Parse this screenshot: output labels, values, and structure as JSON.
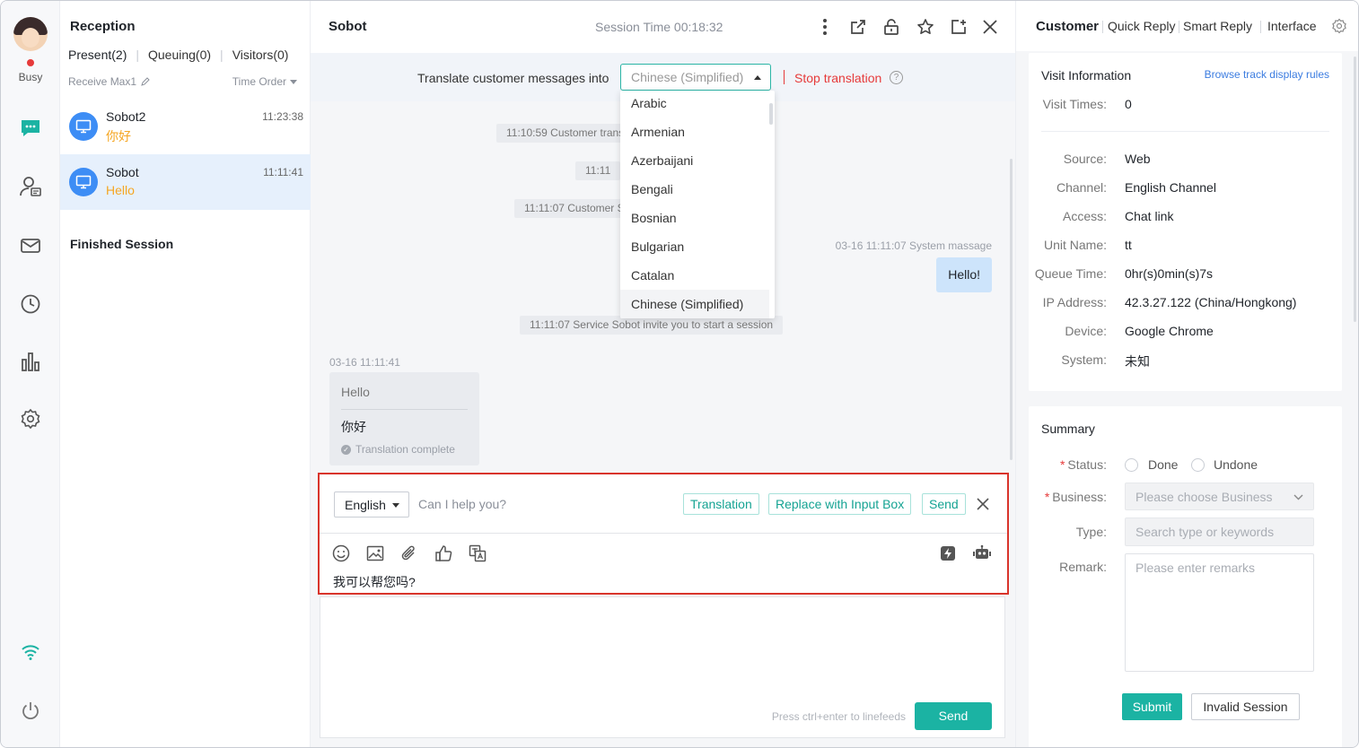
{
  "rail": {
    "status": "Busy",
    "icons": [
      "chat-icon",
      "contacts-icon",
      "mail-icon",
      "history-icon",
      "statistics-icon",
      "settings-icon",
      "wifi-icon",
      "power-icon"
    ]
  },
  "sessions": {
    "title": "Reception",
    "tabs": [
      {
        "label": "Present(2)"
      },
      {
        "label": "Queuing(0)"
      },
      {
        "label": "Visitors(0)"
      }
    ],
    "receive_max": "Receive Max1",
    "time_order": "Time Order",
    "items": [
      {
        "name": "Sobot2",
        "time": "11:23:38",
        "message": "你好"
      },
      {
        "name": "Sobot",
        "time": "11:11:41",
        "message": "Hello"
      }
    ],
    "finished_title": "Finished Session"
  },
  "chat": {
    "name": "Sobot",
    "session_time": "Session Time 00:18:32",
    "translate_label": "Translate customer messages into",
    "target_language": "Chinese (Simplified)",
    "stop_translation": "Stop translation",
    "help_glyph": "?",
    "notes": [
      {
        "text": "11:10:59 Customer transfer to service"
      },
      {
        "text": "11:11:07 Customer Sobot"
      },
      {
        "text": "11:11:07 Service Sobot invite you to start a session"
      }
    ],
    "partial_note": "11:11",
    "outgoing_meta": "03-16 11:11:07   System massage",
    "outgoing_text": "Hello!",
    "incoming_meta": "03-16 11:11:41",
    "incoming_original": "Hello",
    "incoming_translation": "你好",
    "translation_status": "Translation complete",
    "dropdown_options": [
      "Arabic",
      "Armenian",
      "Azerbaijani",
      "Bengali",
      "Bosnian",
      "Bulgarian",
      "Catalan",
      "Chinese (Simplified)"
    ],
    "translate_panel": {
      "source_language": "English",
      "source_text": "Can I help you?",
      "translation_button": "Translation",
      "replace_button": "Replace with Input Box",
      "send_button": "Send",
      "translated_text": "我可以帮您吗?"
    },
    "composer": {
      "hint": "Press ctrl+enter to linefeeds",
      "send": "Send"
    }
  },
  "right": {
    "tabs": [
      "Customer",
      "Quick Reply",
      "Smart Reply",
      "Interface"
    ],
    "visit": {
      "title": "Visit Information",
      "browse_link": "Browse track display rules",
      "visit_times_label": "Visit Times",
      "visit_times": "0",
      "fields": [
        {
          "label": "Source",
          "value": "Web"
        },
        {
          "label": "Channel",
          "value": "English Channel"
        },
        {
          "label": "Access",
          "value": "Chat link"
        },
        {
          "label": "Unit Name",
          "value": "tt"
        },
        {
          "label": "Queue Time",
          "value": "0hr(s)0min(s)7s"
        },
        {
          "label": "IP Address",
          "value": "42.3.27.122 (China/Hongkong)"
        },
        {
          "label": "Device",
          "value": "Google Chrome"
        },
        {
          "label": "System",
          "value": "未知"
        }
      ]
    },
    "summary": {
      "title": "Summary",
      "status_label": "Status",
      "status_options": [
        "Done",
        "Undone"
      ],
      "business_label": "Business",
      "business_placeholder": "Please choose Business",
      "type_label": "Type",
      "type_placeholder": "Search type or keywords",
      "remark_label": "Remark",
      "remark_placeholder": "Please enter remarks",
      "submit": "Submit",
      "invalid": "Invalid Session"
    }
  },
  "colors": {
    "accent": "#1bb3a3",
    "danger": "#d9342b",
    "link": "#3b7ce0",
    "selected_session": "#e6f0fc",
    "unread_message": "#f5a623"
  }
}
